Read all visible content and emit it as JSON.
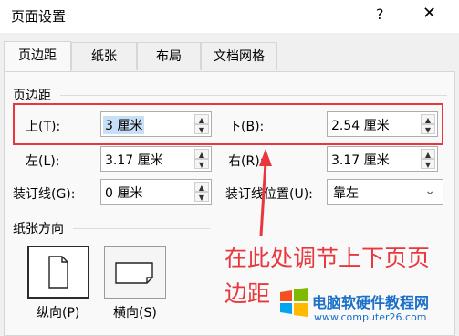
{
  "window": {
    "title": "页面设置",
    "help_glyph": "?",
    "close_glyph": "✕"
  },
  "tabs": [
    {
      "label": "页边距",
      "active": true
    },
    {
      "label": "纸张",
      "active": false
    },
    {
      "label": "布局",
      "active": false
    },
    {
      "label": "文档网格",
      "active": false
    }
  ],
  "margins": {
    "section_title": "页边距",
    "top": {
      "label": "上(T):",
      "value": "3 厘米"
    },
    "bottom": {
      "label": "下(B):",
      "value": "2.54 厘米"
    },
    "left": {
      "label": "左(L):",
      "value": "3.17 厘米"
    },
    "right": {
      "label": "右(R):",
      "value": "3.17 厘米"
    },
    "gutter": {
      "label": "装订线(G):",
      "value": "0 厘米"
    },
    "gutter_position": {
      "label": "装订线位置(U):",
      "value": "靠左"
    }
  },
  "orientation": {
    "section_title": "纸张方向",
    "portrait_label": "纵向(P)",
    "landscape_label": "横向(S)"
  },
  "annotation": {
    "line1": "在此处调节上下页页",
    "line2": "边距"
  },
  "watermark": {
    "site_name": "电脑软硬件教程网",
    "url": "www.computer26.com"
  },
  "colors": {
    "highlight": "#e8383d",
    "selection": "#c7dff7",
    "watermark": "#1a6fc8"
  }
}
